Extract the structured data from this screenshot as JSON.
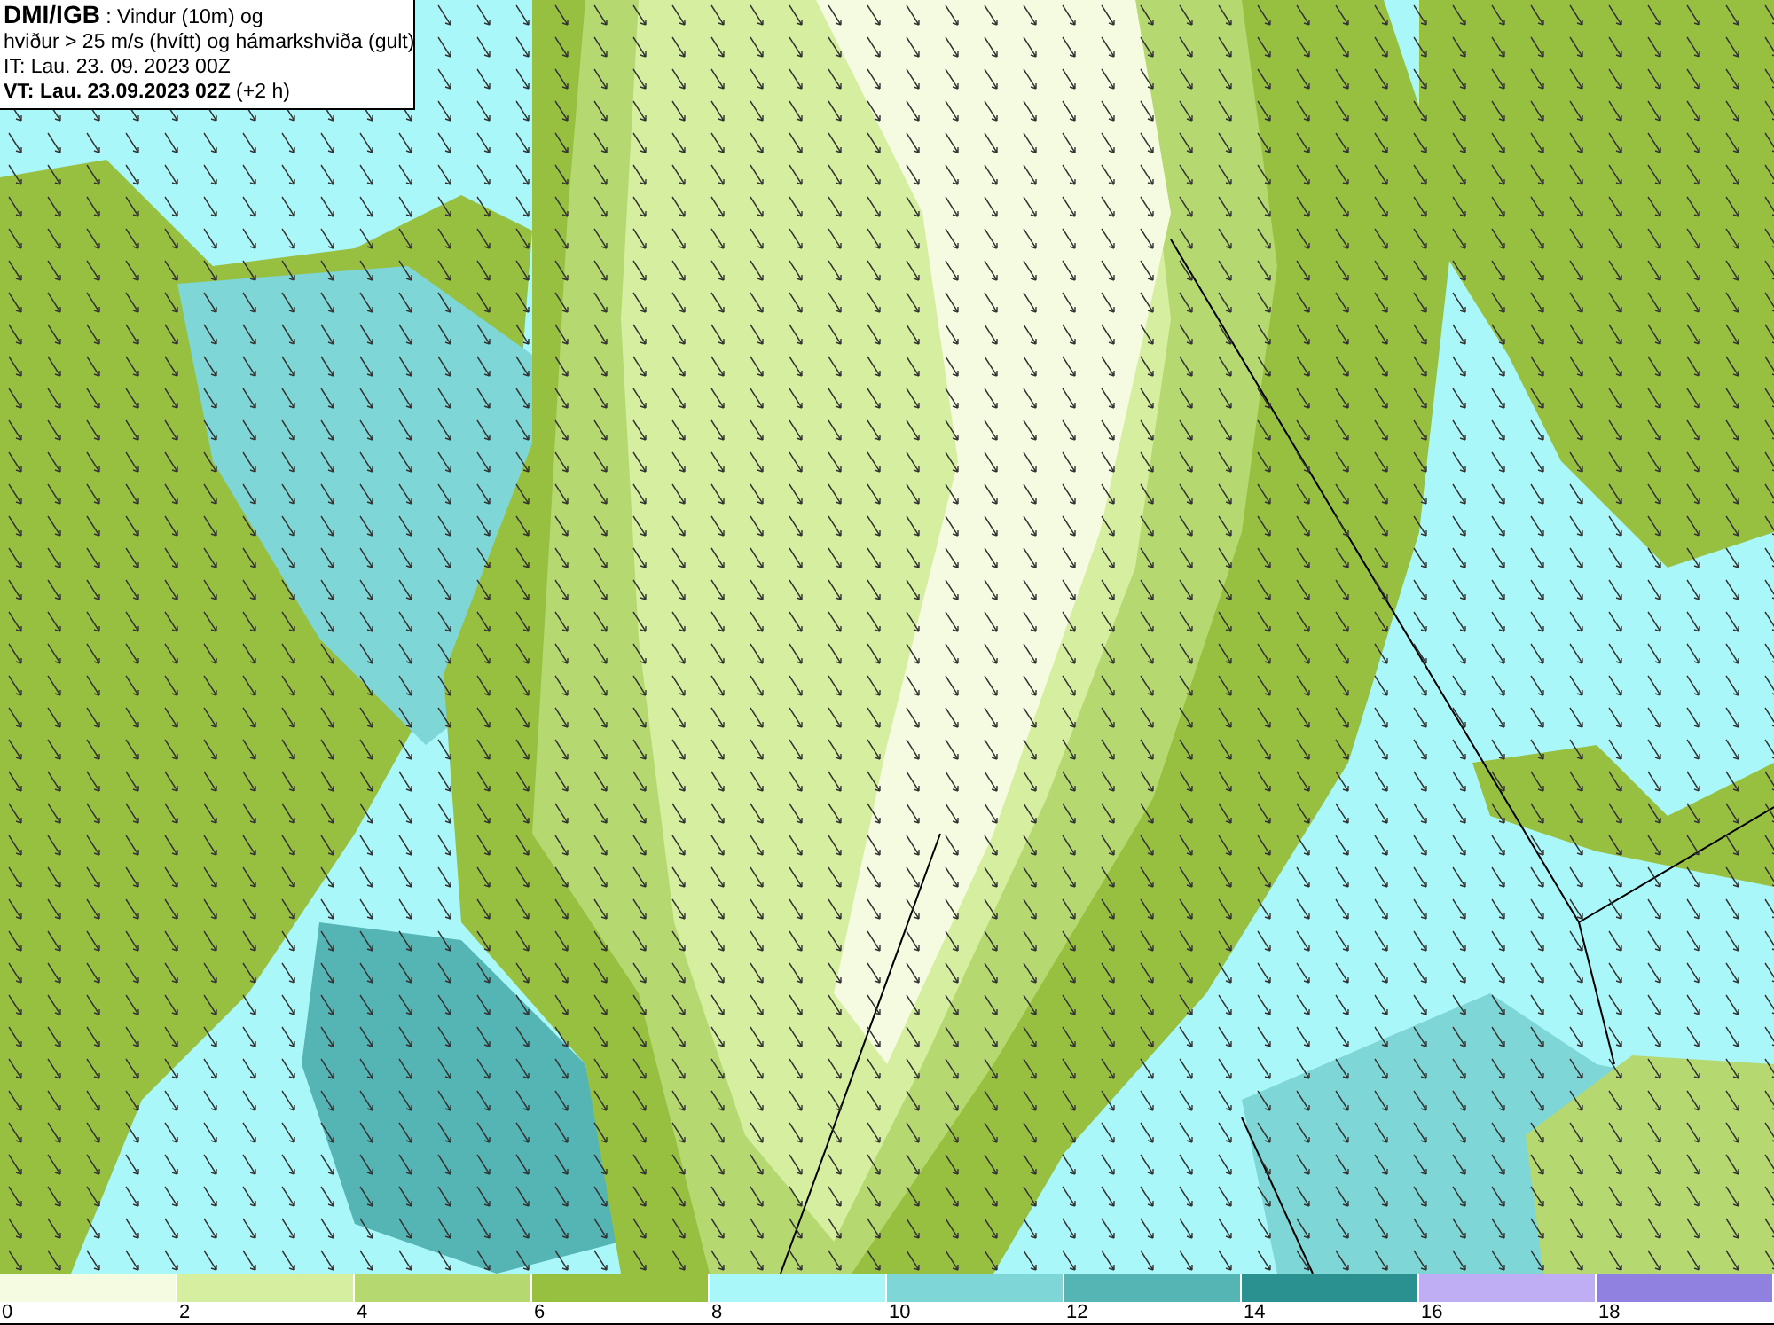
{
  "header": {
    "lines": [
      "**DMI/IGB** : Vindur (10m) og",
      "hviður > 25 m/s (hvítt) og hámarkshviða (gult)",
      "IT: Lau. 23. 09. 2023 00Z",
      "**VT: Lau. 23.09.2023 02Z** (+2 h)"
    ]
  },
  "legend": {
    "segments": [
      {
        "color": "#f4fbe0"
      },
      {
        "color": "#d6eea0"
      },
      {
        "color": "#b5d870"
      },
      {
        "color": "#98c040"
      },
      {
        "color": "#aaf7fa"
      },
      {
        "color": "#7fd6d6"
      },
      {
        "color": "#55b4b4"
      },
      {
        "color": "#2a9090"
      },
      {
        "color": "#c0aef5"
      },
      {
        "color": "#9080e0"
      }
    ],
    "ticks": [
      "0",
      "2",
      "4",
      "6",
      "8",
      "10",
      "12",
      "14",
      "16",
      "18"
    ]
  }
}
